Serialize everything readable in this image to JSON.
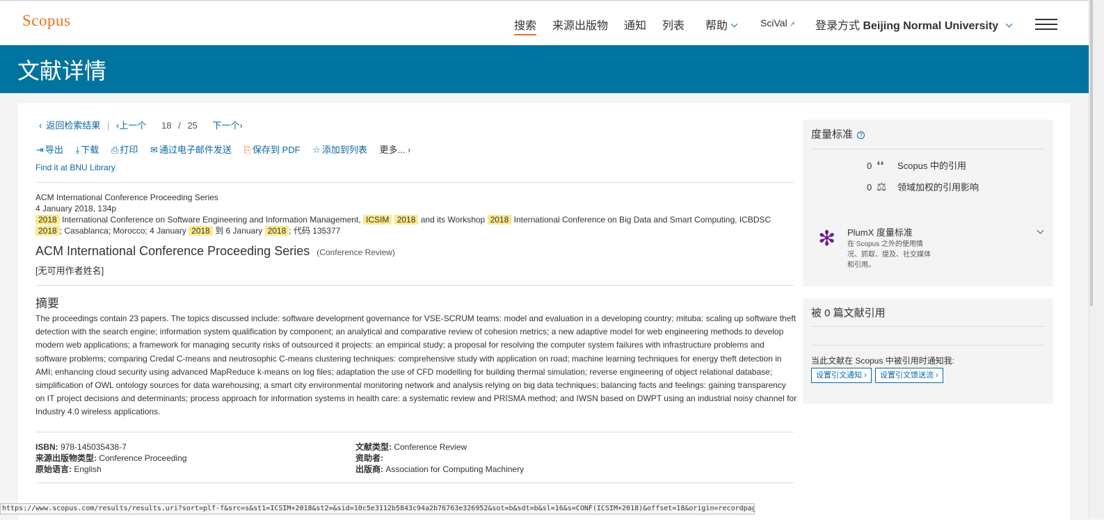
{
  "brand": {
    "logo": "Scopus",
    "accent": "#e9711c",
    "banner_color": "#00739e",
    "link_color": "#0b66a5"
  },
  "topnav": {
    "search": "搜索",
    "sources": "来源出版物",
    "alerts": "通知",
    "lists": "列表",
    "help": "帮助",
    "scival": "SciVal",
    "scival_icon": "external-link-icon",
    "login_prefix": "登录方式",
    "institution": "Beijing Normal University"
  },
  "banner": {
    "title": "文献详情"
  },
  "resultnav": {
    "back": "返回检索结果",
    "prev": "上一个",
    "current": "18",
    "slash": "/",
    "total": "25",
    "next": "下一个"
  },
  "toolbar": {
    "export": "导出",
    "download": "下载",
    "print": "打印",
    "email": "通过电子邮件发送",
    "save_pdf": "保存到 PDF",
    "add_list": "添加到列表",
    "more": "更多..."
  },
  "findit": "Find it at BNU Library",
  "source": {
    "series": "ACM International Conference Proceeding Series",
    "date_pages": "4 January 2018, 134p",
    "hl_2018": "2018",
    "hl_icsim": "ICSIM",
    "conf_part1": "International Conference on Software Engineering and Information Management,",
    "conf_part2": "and its Workshop",
    "conf_part3": "International Conference on Big Data and Smart Computing, ICBDSC",
    "conf_part4": "; Casablanca; Morocco; 4 January",
    "conf_part5": "到 6 January",
    "conf_part6": "; 代码 135377"
  },
  "document": {
    "title": "ACM International Conference Proceeding Series",
    "type": "(Conference Review)",
    "author": "[无可用作者姓名]"
  },
  "abstract": {
    "heading": "摘要",
    "text": "The proceedings contain 23 papers. The topics discussed include: software development governance for VSE-SCRUM teams: model and evaluation in a developing country; mituba: scaling up software theft detection with the search engine; information system qualification by component; an analytical and comparative review of cohesion metrics; a new adaptive model for web engineering methods to develop modern web applications; a framework for managing security risks of outsourced it projects: an empirical study; a proposal for resolving the computer system failures with infrastructure problems and software problems; comparing Credal C-means and neutrosophic C-means clustering techniques: comprehensive study with application on road; machine learning techniques for energy theft detection in AMI; enhancing cloud security using advanced MapReduce k-means on log files; adaptation the use of CFD modelling for building thermal simulation; reverse engineering of object relational database; simplification of OWL ontology sources for data warehousing; a smart city environmental monitoring network and analysis relying on big data techniques; balancing facts and feelings: gaining transparency on IT project decisions and determinants; process approach for information systems in health care: a systematic review and PRISMA method; and IWSN based on DWPT using an industrial noisy channel for Industry 4.0 wireless applications."
  },
  "meta": {
    "isbn_label": "ISBN:",
    "isbn": "978-145035438-7",
    "srctype_label": "来源出版物类型:",
    "srctype": "Conference Proceeding",
    "lang_label": "原始语言:",
    "lang": "English",
    "doctype_label": "文献类型:",
    "doctype": "Conference Review",
    "sponsor_label": "资助者:",
    "publisher_label": "出版商:",
    "publisher": "Association for Computing Machinery"
  },
  "metrics": {
    "title": "度量标准",
    "help_icon": "?",
    "cite_count": "0",
    "cite_label": "Scopus 中的引用",
    "fwci": "0",
    "fwci_label": "领域加权的引用影响",
    "plumx_title": "PlumX 度量标准",
    "plumx_desc": "在 Scopus 之外的使用情况、抓取、提及、社交媒体和引用。"
  },
  "citedby": {
    "title": "被 0 篇文献引用",
    "notify": "当此文献在 Scopus 中被引用时通知我:",
    "btn_alert": "设置引文通知 ›",
    "btn_feed": "设置引文馈送流 ›"
  },
  "status_url": "https://www.scopus.com/results/results.uri?sort=plf-f&src=s&st1=ICSIM+2018&st2=&sid=10c5e3112b5843c94a2b76763e326952&sot=b&sdt=b&sl=16&s=CONF(ICSIM+2018)&offset=18&origin=recordpage"
}
